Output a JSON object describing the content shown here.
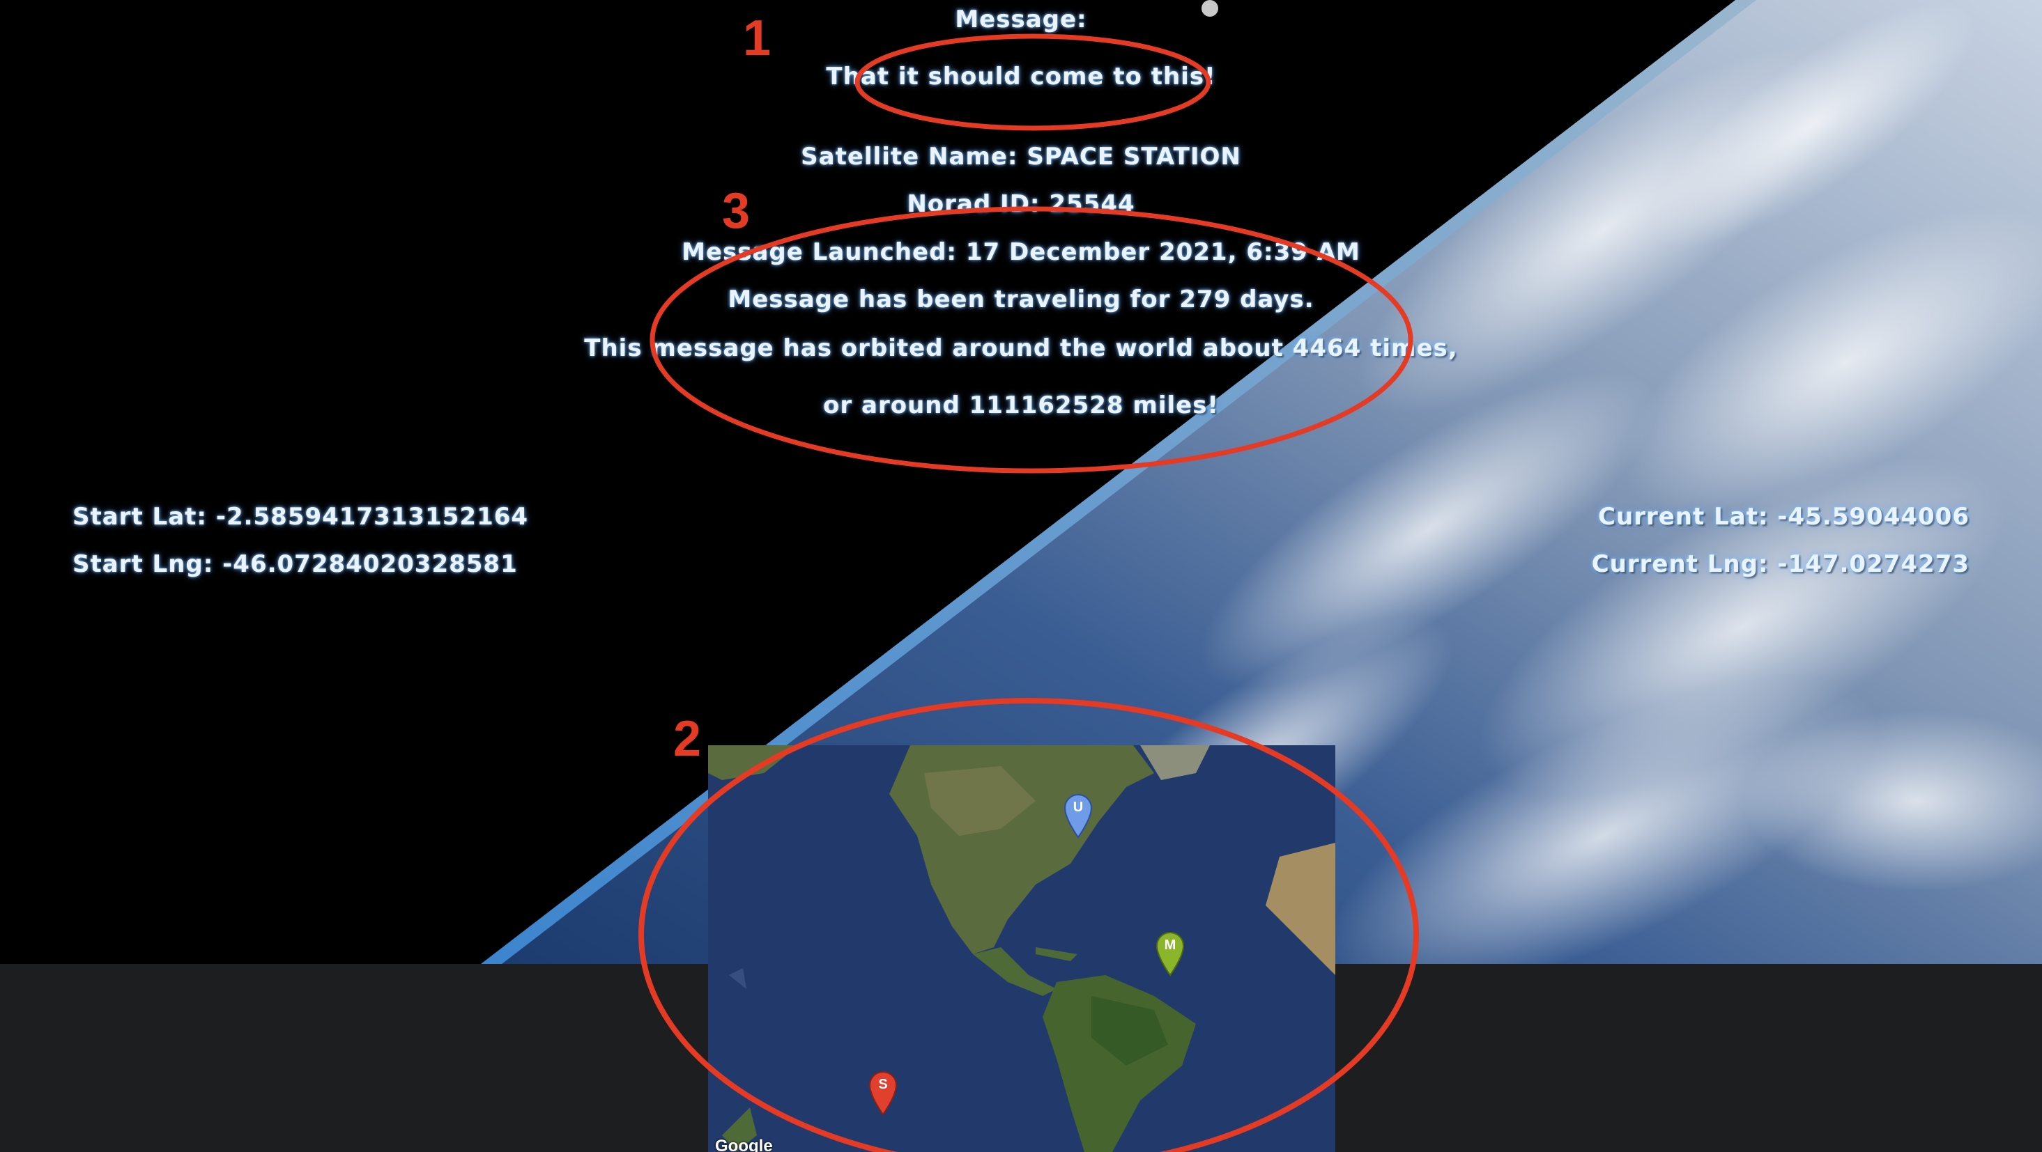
{
  "message_section": {
    "label": "Message:",
    "text": "That it should come to this!"
  },
  "satellite": {
    "name_line": "Satellite Name: SPACE STATION",
    "norad_line": "Norad ID: 25544"
  },
  "stats": {
    "launched": "Message Launched: 17 December 2021, 6:39 AM",
    "traveling": "Message has been traveling for 279 days.",
    "orbited": "This message has orbited around the world about 4464 times,",
    "miles": "or around 111162528 miles!"
  },
  "start_coords": {
    "lat": "Start Lat: -2.5859417313152164",
    "lng": "Start Lng: -46.07284020328581"
  },
  "current_coords": {
    "lat": "Current Lat: -45.59044006",
    "lng": "Current Lng: -147.0274273"
  },
  "map": {
    "attribution": "Google",
    "markers": [
      {
        "letter": "U",
        "color": "#6f9be8"
      },
      {
        "letter": "M",
        "color": "#8bb52a"
      },
      {
        "letter": "S",
        "color": "#e1402f"
      }
    ]
  },
  "annotations": {
    "labels": [
      "1",
      "2",
      "3"
    ],
    "color": "#e53a24"
  },
  "colors": {
    "background_space": "#000000",
    "background_band": "#1d1e20",
    "text_glow": "#e9f4ff"
  }
}
